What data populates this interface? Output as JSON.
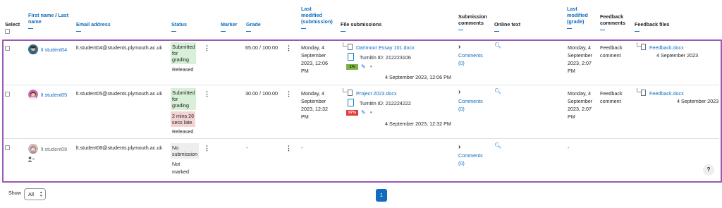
{
  "headers": {
    "select": "Select",
    "name_first": "First name",
    "name_sep": " / ",
    "name_last": "Last",
    "name_last2": "name",
    "email": "Email address",
    "status": "Status",
    "marker": "Marker",
    "grade": "Grade",
    "lm_sub_1": "Last",
    "lm_sub_2": "modified",
    "lm_sub_3": "(submission)",
    "file_submissions": "File submissions",
    "sub_comments_1": "Submission",
    "sub_comments_2": "comments",
    "online_text": "Online text",
    "lm_grade_1": "Last",
    "lm_grade_2": "modified",
    "lm_grade_3": "(grade)",
    "fb_comments_1": "Feedback",
    "fb_comments_2": "comments",
    "fb_files": "Feedback files"
  },
  "rows": [
    {
      "name": "lt student04",
      "email": "lt.student04@students.plymouth.ac.uk",
      "status_lines": [
        "Submitted",
        "for",
        "grading"
      ],
      "status_extra": "Released",
      "grade": "65.00 / 100.00",
      "lm_sub": [
        "Monday, 4",
        "September",
        "2023, 12:06",
        "PM"
      ],
      "file_name": "Dartmoor Essay 101.docx",
      "turnitin": "Turnitin ID: 212223106",
      "similarity": "1%",
      "file_date": "4 September 2023, 12:06 PM",
      "comments": [
        "Comments",
        "(0)"
      ],
      "lm_grade": [
        "Monday, 4",
        "September",
        "2023, 2:07",
        "PM"
      ],
      "fb_comment": [
        "Feedback",
        "comment"
      ],
      "fb_file": "Feedback.docx",
      "fb_date": "4 September 2023"
    },
    {
      "name": "lt student05",
      "email": "lt.student05@students.plymouth.ac.uk",
      "status_lines": [
        "Submitted",
        "for",
        "grading"
      ],
      "status_late": [
        "2 mins 26",
        "secs late"
      ],
      "status_extra": "Released",
      "grade": "30.00 / 100.00",
      "lm_sub": [
        "Monday, 4",
        "September",
        "2023, 12:32",
        "PM"
      ],
      "file_name": "Project 2023.docx",
      "turnitin": "Turnitin ID: 212224222",
      "similarity": "97%",
      "file_date": "4 September 2023, 12:32 PM",
      "comments": [
        "Comments",
        "(0)"
      ],
      "lm_grade": [
        "Monday, 4",
        "September",
        "2023, 2:07",
        "PM"
      ],
      "fb_comment": [
        "Feedback",
        "comment"
      ],
      "fb_file": "Feedback.docx",
      "fb_date": "4 September 2023"
    },
    {
      "name": "lt student08",
      "email": "lt.student08@students.plymouth.ac.uk",
      "status_lines": [
        "No",
        "submission"
      ],
      "status_extra": "Not",
      "status_extra2": "marked",
      "grade": "-",
      "lm_sub_dash": "-",
      "comments": [
        "Comments",
        "(0)"
      ],
      "lm_grade_dash": "-"
    }
  ],
  "footer": {
    "show_label": "Show",
    "show_value": "All",
    "page": "1",
    "help": "?"
  },
  "colors": {
    "link": "#0f6cbf",
    "submitted_bg": "#d7f0d7",
    "late_bg": "#f4d3d3",
    "nosub_bg": "#eeeeee",
    "sim_low": "#7cb342",
    "sim_high": "#e53935",
    "frame": "#9b59b6"
  }
}
